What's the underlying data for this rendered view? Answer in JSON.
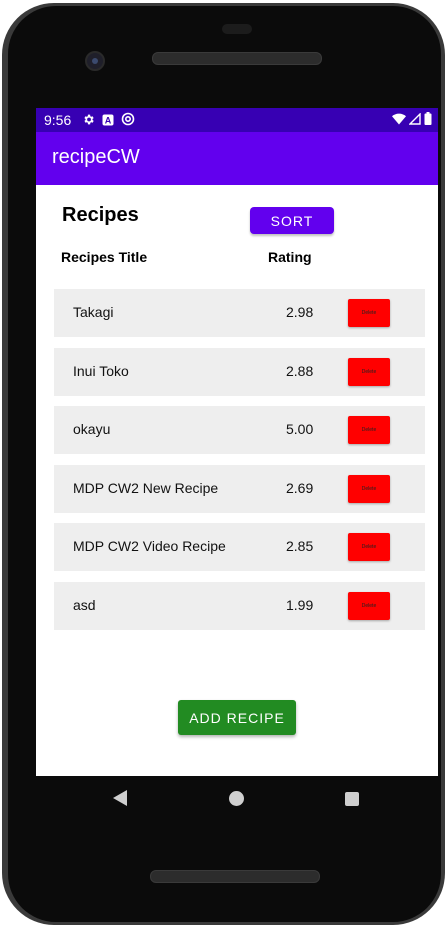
{
  "status_bar": {
    "time": "9:56",
    "icons_left": [
      "gear-icon",
      "a-badge-icon",
      "at-circle-icon"
    ],
    "icons_right": [
      "wifi-icon",
      "signal-icon",
      "battery-icon"
    ],
    "color": "#3700b3"
  },
  "app_bar": {
    "title": "recipeCW",
    "color": "#6200ee"
  },
  "main": {
    "heading": "Recipes",
    "sort_label": "SORT",
    "columns": {
      "title": "Recipes Title",
      "rating": "Rating"
    },
    "recipes": [
      {
        "title": "Takagi",
        "rating": "2.98",
        "delete_label": "Delete"
      },
      {
        "title": "Inui Toko",
        "rating": "2.88",
        "delete_label": "Delete"
      },
      {
        "title": "okayu",
        "rating": "5.00",
        "delete_label": "Delete"
      },
      {
        "title": "MDP CW2 New Recipe",
        "rating": "2.69",
        "delete_label": "Delete"
      },
      {
        "title": "MDP CW2 Video Recipe",
        "rating": "2.85",
        "delete_label": "Delete"
      },
      {
        "title": "asd",
        "rating": "1.99",
        "delete_label": "Delete"
      }
    ],
    "add_label": "ADD RECIPE",
    "colors": {
      "delete": "#ff0000",
      "add": "#228b22",
      "row_bg": "#eeeeee"
    }
  },
  "nav_bar": {
    "icons": [
      "back-icon",
      "home-icon",
      "recents-icon"
    ]
  }
}
